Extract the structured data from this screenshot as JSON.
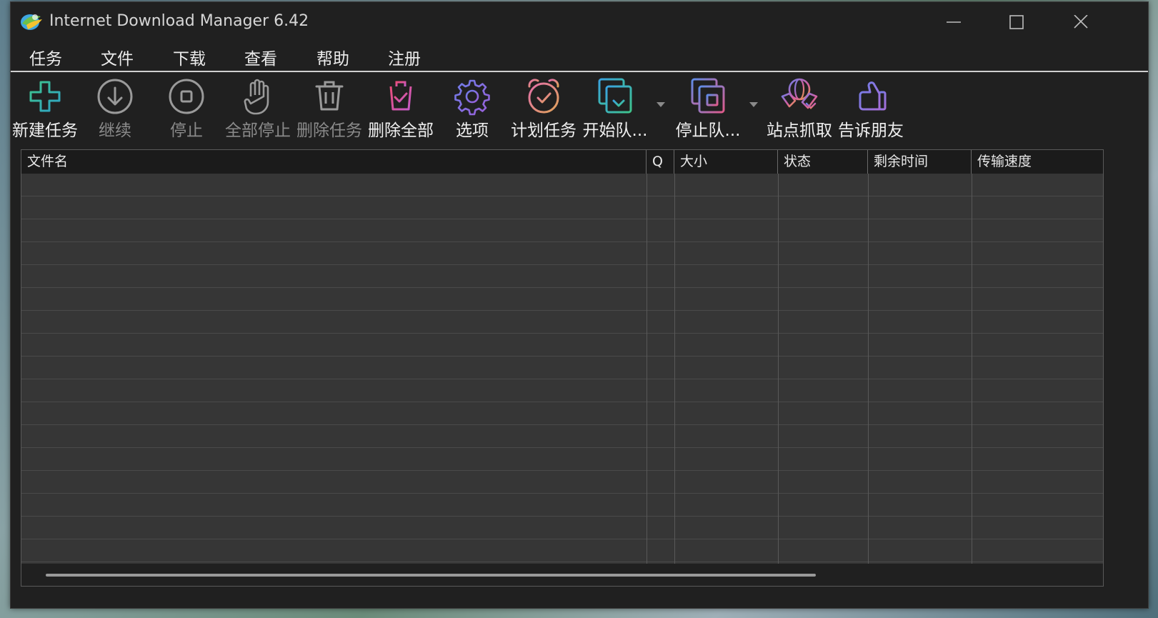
{
  "window": {
    "title": "Internet Download Manager 6.42"
  },
  "menu": [
    "任务",
    "文件",
    "下载",
    "查看",
    "帮助",
    "注册"
  ],
  "toolbar": [
    {
      "label": "新建任务",
      "icon": "plus-icon",
      "enabled": true
    },
    {
      "label": "继续",
      "icon": "download-arrow-icon",
      "enabled": false
    },
    {
      "label": "停止",
      "icon": "stop-icon",
      "enabled": false
    },
    {
      "label": "全部停止",
      "icon": "hand-icon",
      "enabled": false
    },
    {
      "label": "删除任务",
      "icon": "trash-icon",
      "enabled": false
    },
    {
      "label": "删除全部",
      "icon": "trash-check-icon",
      "enabled": true
    },
    {
      "label": "选项",
      "icon": "gear-icon",
      "enabled": true
    },
    {
      "label": "计划任务",
      "icon": "alarm-clock-icon",
      "enabled": true
    },
    {
      "label": "开始队...",
      "icon": "queue-start-icon",
      "enabled": true
    },
    {
      "label": "停止队...",
      "icon": "queue-stop-icon",
      "enabled": true
    },
    {
      "label": "站点抓取",
      "icon": "site-grabber-icon",
      "enabled": true
    },
    {
      "label": "告诉朋友",
      "icon": "thumbs-up-icon",
      "enabled": true
    }
  ],
  "columns": [
    "文件名",
    "Q",
    "大小",
    "状态",
    "剩余时间",
    "传输速度"
  ],
  "colors": {
    "window_bg": "#202020",
    "list_bg": "#363636",
    "header_bg": "#1b1b1b",
    "disabled_text": "#8a8a8a"
  }
}
